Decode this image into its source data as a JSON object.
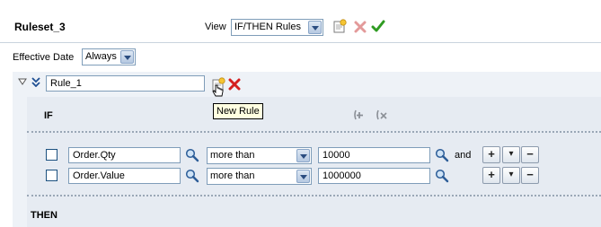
{
  "header": {
    "ruleset_title": "Ruleset_3",
    "view_label": "View",
    "view_value": "IF/THEN Rules"
  },
  "effective_date": {
    "label": "Effective Date",
    "value": "Always"
  },
  "rule": {
    "name": "Rule_1",
    "tooltip": "New Rule",
    "if_label": "IF",
    "then_label": "THEN",
    "conditions": [
      {
        "field": "Order.Qty",
        "operator": "more than",
        "value": "10000",
        "connector": "and"
      },
      {
        "field": "Order.Value",
        "operator": "more than",
        "value": "1000000",
        "connector": ""
      }
    ],
    "controls": {
      "add": "+",
      "menu": "▾",
      "remove": "−"
    }
  },
  "colors": {
    "accent_blue": "#1f4f93",
    "delete_red": "#d41f1f",
    "confirm_green": "#2f9b22",
    "tooltip_bg": "#ffffe1",
    "panel_bg": "#eef2f7"
  },
  "icons": [
    "new-rule-icon",
    "delete-icon",
    "validate-icon",
    "search-icon",
    "add-test-icon",
    "remove-test-icon",
    "collapse-triangle-icon",
    "double-chevron-icon"
  ]
}
